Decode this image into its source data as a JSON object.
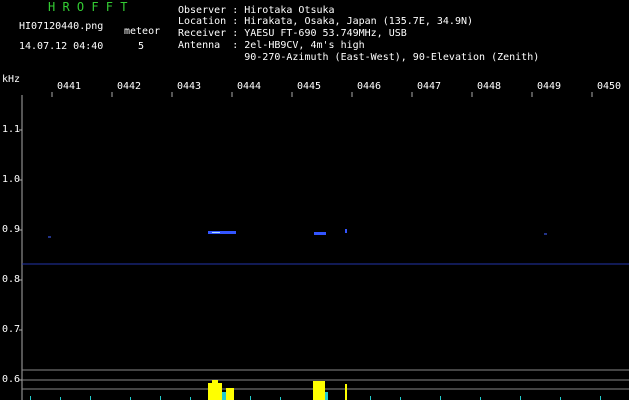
{
  "header": {
    "title": "H R O F F T",
    "filename": "HI07120440.png",
    "timestamp": "14.07.12 04:40",
    "meteor_label": "meteor",
    "meteor_count": "5"
  },
  "station": [
    {
      "key": "Observer ",
      "sep": ": ",
      "value": "Hirotaka Otsuka"
    },
    {
      "key": "Location ",
      "sep": ": ",
      "value": "Hirakata, Osaka, Japan (135.7E, 34.9N)"
    },
    {
      "key": "Receiver ",
      "sep": ": ",
      "value": "YAESU FT-690 53.749MHz, USB"
    },
    {
      "key": "Antenna  ",
      "sep": ": ",
      "value": "2el-HB9CV, 4m's high"
    },
    {
      "key": "         ",
      "sep": "  ",
      "value": "90-270-Azimuth (East-West), 90-Elevation (Zenith)"
    }
  ],
  "axes": {
    "y_unit": "kHz",
    "y_ticks": [
      "1.1",
      "1.0",
      "0.9",
      "0.8",
      "0.7",
      "0.6"
    ],
    "x_ticks": [
      "0441",
      "0442",
      "0443",
      "0444",
      "0445",
      "0446",
      "0447",
      "0448",
      "0449",
      "0450"
    ]
  },
  "colors": {
    "title": "#33cc33",
    "baseline": "#2233aa",
    "signal": "#ffff00",
    "noise": "#22cccc"
  }
}
